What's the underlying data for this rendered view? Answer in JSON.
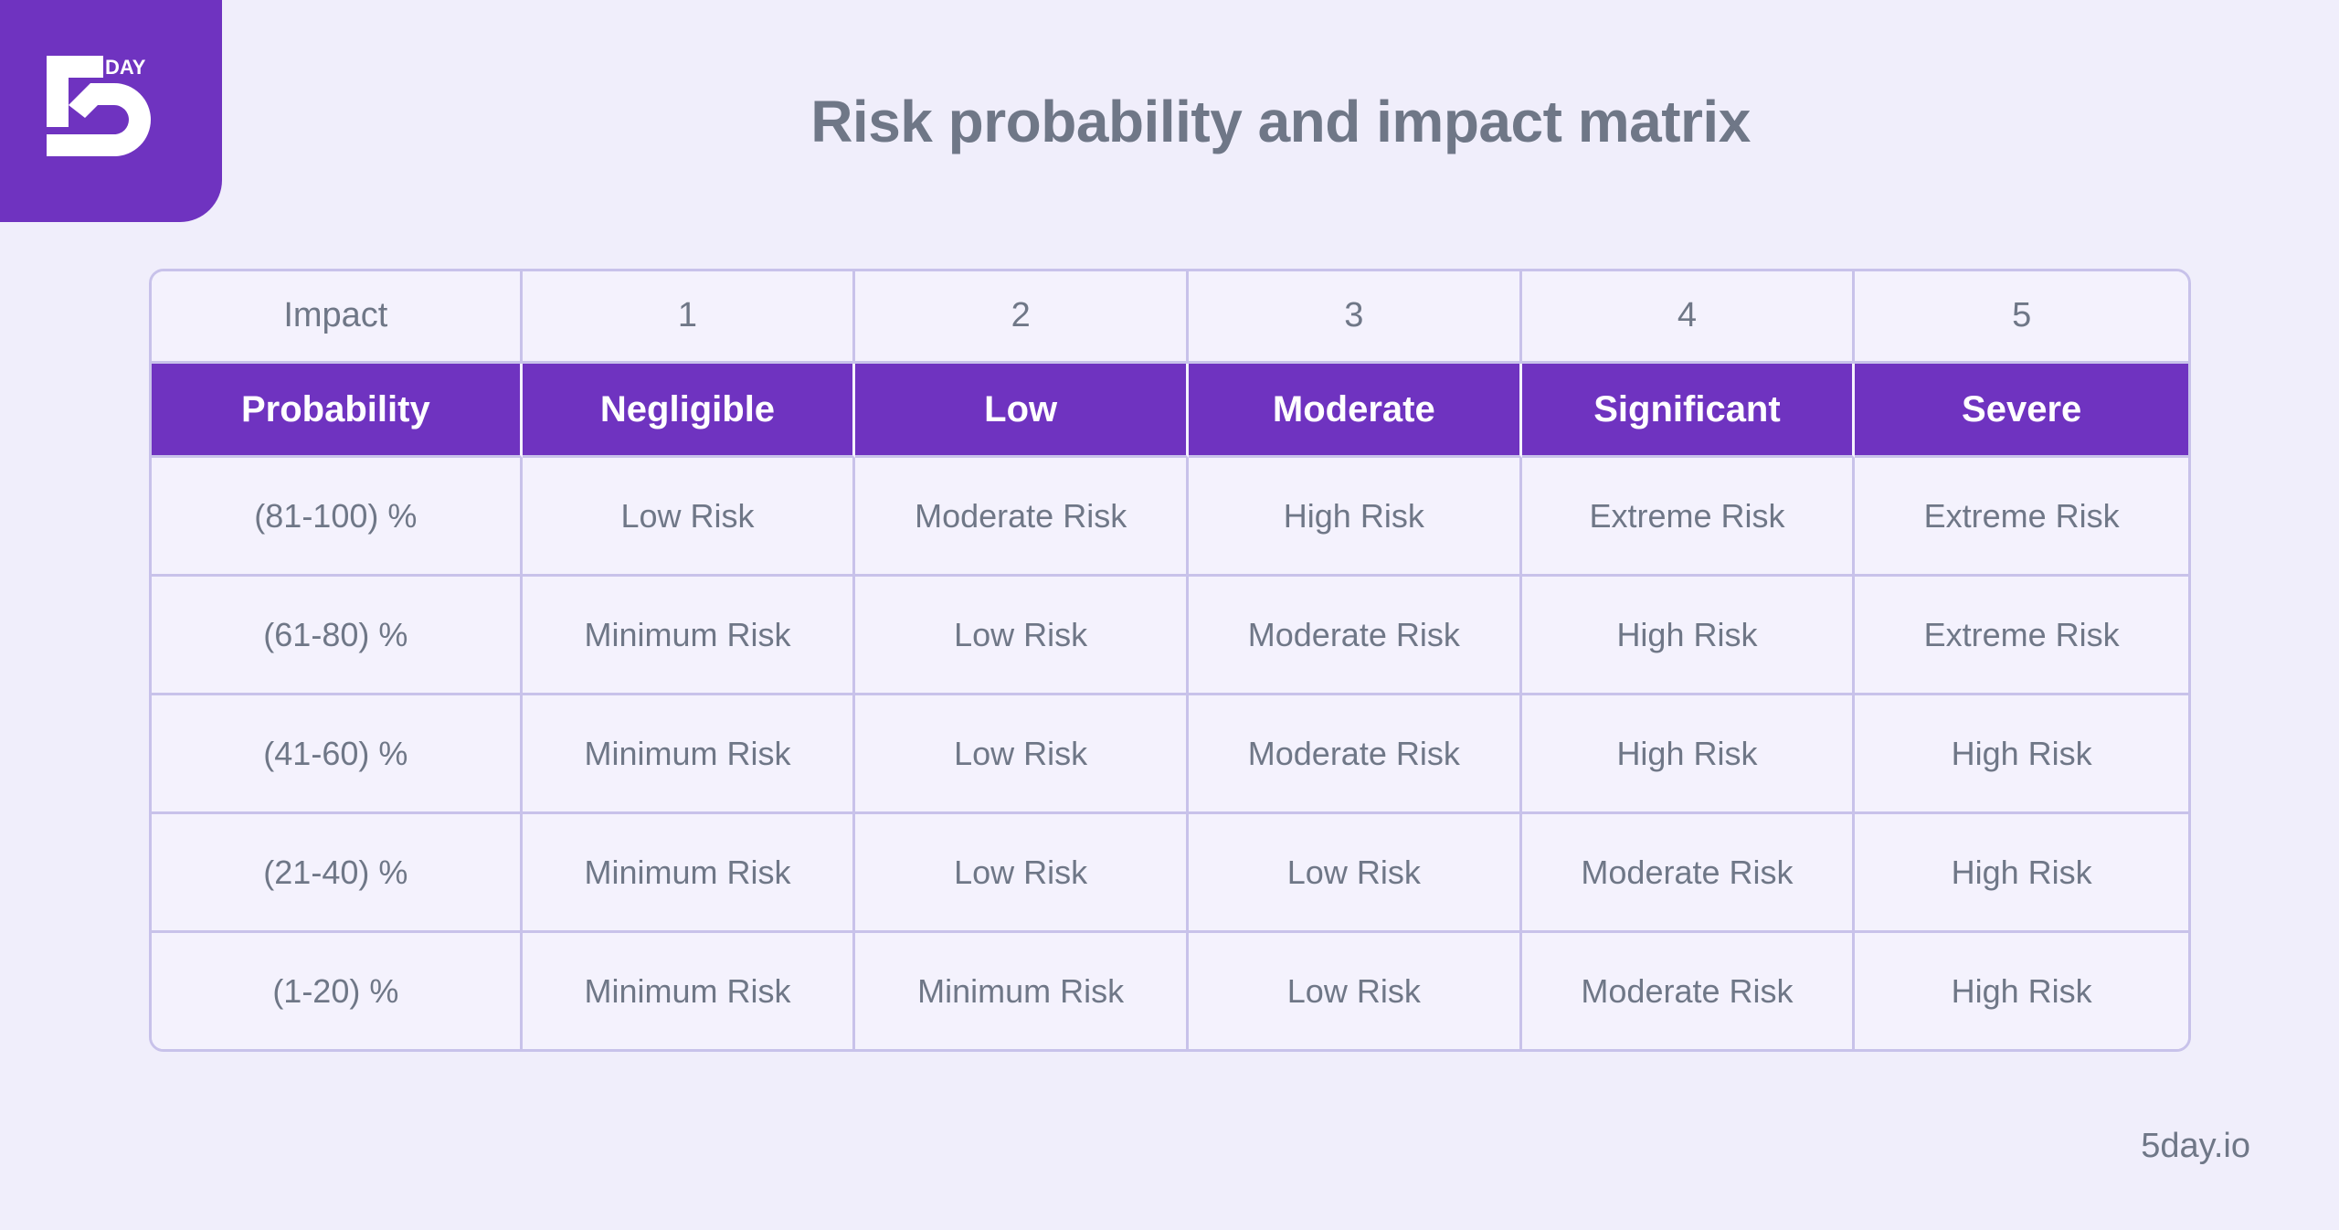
{
  "brand": {
    "logo_name": "5day-logo",
    "logo_mark_text": "5",
    "logo_day_text": "DAY",
    "logo_bg_color": "#6f33c0",
    "footer_text": "5day.io"
  },
  "page": {
    "title": "Risk probability and impact matrix",
    "background_color": "#f0eefb",
    "title_color": "#6f7787"
  },
  "colors": {
    "purple": "#6f33c0",
    "border": "#c8c2ea",
    "cell_bg": "#f4f2fd",
    "minimum": "#c6f8a5",
    "low": "#99fb7f",
    "moderate": "#faf08c",
    "high": "#f9c792",
    "extreme": "#fca5a5"
  },
  "chart_data": {
    "type": "heatmap",
    "title": "Risk probability and impact matrix",
    "xlabel": "Impact",
    "ylabel": "Probability",
    "impact_header_label": "Impact",
    "probability_header_label": "Probability",
    "impact_scores": [
      "1",
      "2",
      "3",
      "4",
      "5"
    ],
    "impact_categories": [
      "Negligible",
      "Low",
      "Moderate",
      "Significant",
      "Severe"
    ],
    "probability_bands": [
      "(81-100) %",
      "(61-80) %",
      "(41-60) %",
      "(21-40) %",
      "(1-20) %"
    ],
    "legend": [
      {
        "label": "Minimum Risk",
        "color": "#c6f8a5"
      },
      {
        "label": "Low Risk",
        "color": "#99fb7f"
      },
      {
        "label": "Moderate Risk",
        "color": "#faf08c"
      },
      {
        "label": "High Risk",
        "color": "#f9c792"
      },
      {
        "label": "Extreme Risk",
        "color": "#fca5a5"
      }
    ],
    "rows": [
      {
        "band": "(81-100) %",
        "cells": [
          {
            "label": "Low Risk",
            "level": "low"
          },
          {
            "label": "Moderate Risk",
            "level": "moderate"
          },
          {
            "label": "High Risk",
            "level": "high"
          },
          {
            "label": "Extreme Risk",
            "level": "extreme"
          },
          {
            "label": "Extreme Risk",
            "level": "extreme"
          }
        ]
      },
      {
        "band": "(61-80) %",
        "cells": [
          {
            "label": "Minimum Risk",
            "level": "minimum"
          },
          {
            "label": "Low Risk",
            "level": "low"
          },
          {
            "label": "Moderate Risk",
            "level": "moderate"
          },
          {
            "label": "High Risk",
            "level": "high"
          },
          {
            "label": "Extreme Risk",
            "level": "extreme"
          }
        ]
      },
      {
        "band": "(41-60) %",
        "cells": [
          {
            "label": "Minimum Risk",
            "level": "minimum"
          },
          {
            "label": "Low Risk",
            "level": "low"
          },
          {
            "label": "Moderate Risk",
            "level": "moderate"
          },
          {
            "label": "High Risk",
            "level": "high"
          },
          {
            "label": "High Risk",
            "level": "high"
          }
        ]
      },
      {
        "band": "(21-40) %",
        "cells": [
          {
            "label": "Minimum Risk",
            "level": "minimum"
          },
          {
            "label": "Low Risk",
            "level": "low"
          },
          {
            "label": "Low Risk",
            "level": "low"
          },
          {
            "label": "Moderate Risk",
            "level": "moderate"
          },
          {
            "label": "High Risk",
            "level": "high"
          }
        ]
      },
      {
        "band": "(1-20) %",
        "cells": [
          {
            "label": "Minimum Risk",
            "level": "minimum"
          },
          {
            "label": "Minimum Risk",
            "level": "minimum"
          },
          {
            "label": "Low Risk",
            "level": "low"
          },
          {
            "label": "Moderate Risk",
            "level": "moderate"
          },
          {
            "label": "High Risk",
            "level": "high"
          }
        ]
      }
    ]
  }
}
